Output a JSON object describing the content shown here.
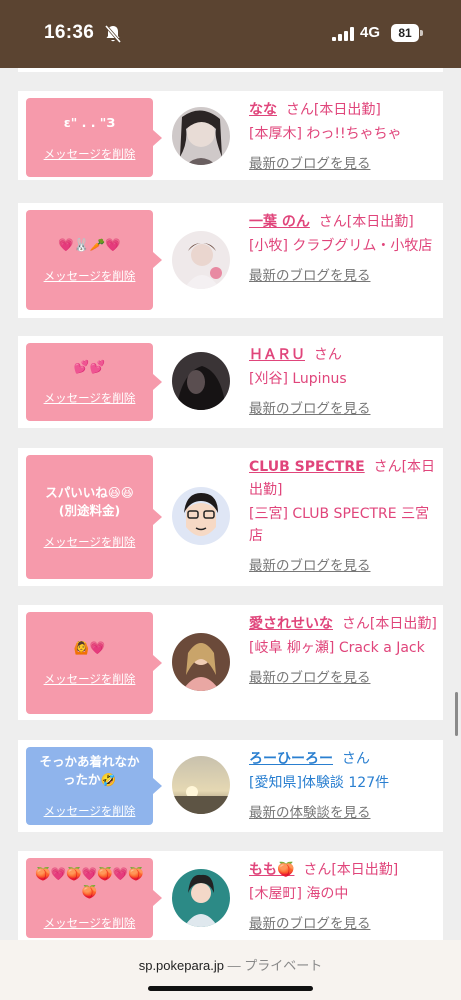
{
  "status_bar": {
    "time": "16:36",
    "network": "4G",
    "battery": "81",
    "icons": [
      "bell-slash-icon",
      "signal-icon",
      "battery-icon"
    ]
  },
  "colors": {
    "status_bar": "#5b4431",
    "bubble_pink": "#f69aab",
    "bubble_blue": "#8fb4ec",
    "name_pink": "#e0457b",
    "name_blue": "#2a7fd0"
  },
  "cards": [
    {
      "bubble": "ε\" . . \"З",
      "delete": "メッセージを削除",
      "name": "なな",
      "san": "さん",
      "tag": "[本日出勤]",
      "shop": "[本厚木] わっ!!ちゃちゃ",
      "link": "最新のブログを見る"
    },
    {
      "bubble": "💗🐰🥕💗",
      "delete": "メッセージを削除",
      "name": "一葉 のん",
      "san": "さん",
      "tag": "[本日出勤]",
      "shop": "[小牧] クラブグリム・小牧店",
      "link": "最新のブログを見る"
    },
    {
      "bubble": "💕💕",
      "delete": "メッセージを削除",
      "name": "ＨＡＲＵ",
      "san": "さん",
      "tag": "",
      "shop": "[刈谷] Lupinus",
      "link": "最新のブログを見る"
    },
    {
      "bubble": "スパいいね😆😆 (別途料金)",
      "delete": "メッセージを削除",
      "name": "CLUB SPECTRE",
      "san": "さん",
      "tag": "[本日出勤]",
      "shop": "[三宮] CLUB SPECTRE 三宮店",
      "link": "最新のブログを見る"
    },
    {
      "bubble": "🙆💗",
      "delete": "メッセージを削除",
      "name": "愛されせいな",
      "san": "さん",
      "tag": "[本日出勤]",
      "shop": "[岐阜 柳ヶ瀬] Crack a Jack",
      "link": "最新のブログを見る"
    },
    {
      "bubble": "そっかあ着れなかったか🤣",
      "delete": "メッセージを削除",
      "name": "ろーひーろー",
      "san": "さん",
      "tag": "",
      "shop": "[愛知県]体験談 127件",
      "link": "最新の体験談を見る"
    },
    {
      "bubble": "🍑💗🍑💗🍑💗🍑🍑",
      "delete": "メッセージを削除",
      "name": "もも🍑",
      "san": "さん",
      "tag": "[本日出勤]",
      "shop": "[木屋町] 海の中",
      "link": "最新のブログを見る"
    }
  ],
  "url_bar": {
    "domain": "sp.pokepara.jp",
    "separator": "—",
    "mode": "プライベート"
  }
}
